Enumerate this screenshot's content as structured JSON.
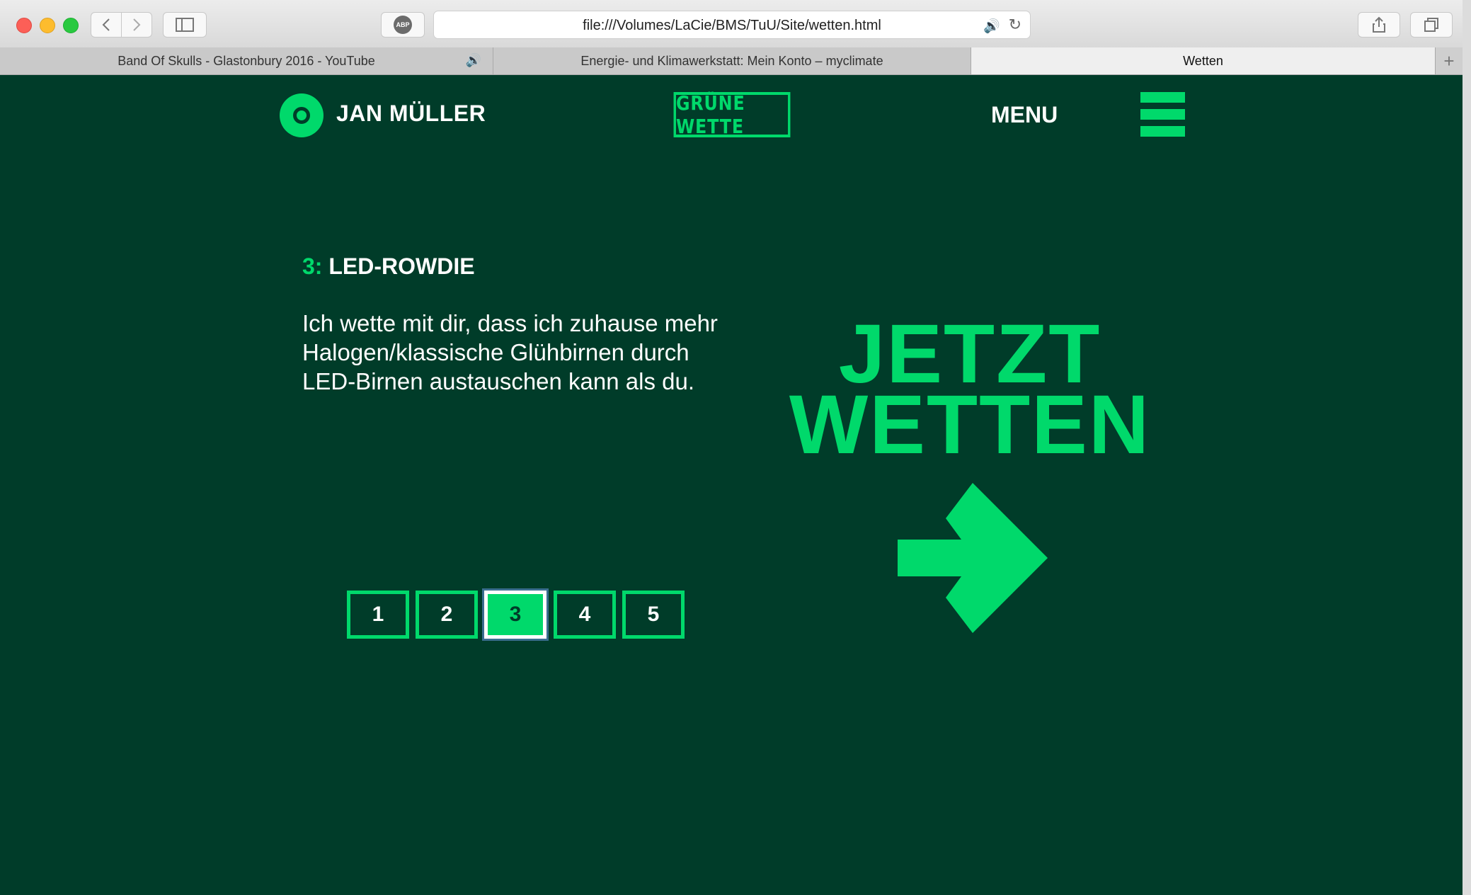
{
  "browser": {
    "url": "file:///Volumes/LaCie/BMS/TuU/Site/wetten.html",
    "abp_label": "ABP",
    "tabs": [
      {
        "label": "Band Of Skulls - Glastonbury 2016 - YouTube",
        "audio": true
      },
      {
        "label": "Energie- und Klimawerkstatt: Mein Konto – myclimate",
        "audio": false
      },
      {
        "label": "Wetten",
        "audio": false,
        "active": true
      }
    ]
  },
  "header": {
    "user_name": "JAN MÜLLER",
    "brand": "GRÜNE WETTE",
    "menu_label": "MENU"
  },
  "bet": {
    "number": "3:",
    "title": "LED-ROWDIE",
    "description": "Ich wette mit dir, dass ich zuhause mehr Halogen/klassische Glühbirnen durch LED-Birnen austauschen kann als du."
  },
  "pagination": {
    "pages": [
      "1",
      "2",
      "3",
      "4",
      "5"
    ],
    "active": "3"
  },
  "cta": {
    "line1": "JETZT",
    "line2": "WETTEN"
  },
  "colors": {
    "background": "#003c29",
    "accent": "#00d96b",
    "text": "#ffffff"
  }
}
